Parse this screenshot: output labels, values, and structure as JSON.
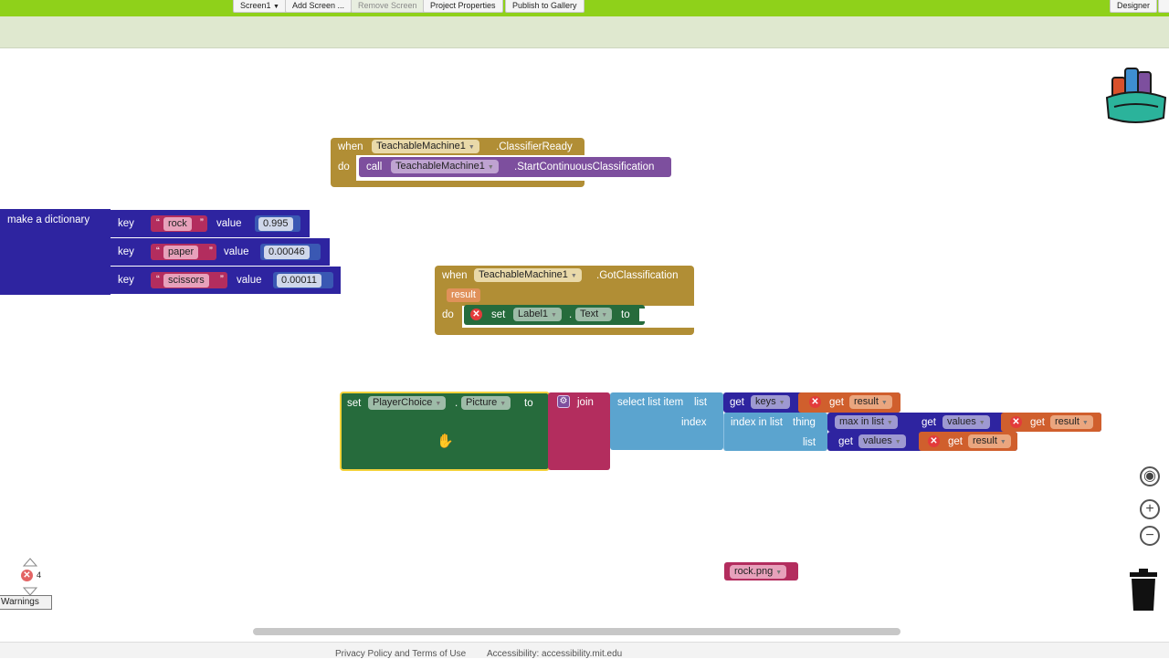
{
  "toolbar": {
    "screen_select": "Screen1",
    "add_screen": "Add Screen ...",
    "remove_screen": "Remove Screen",
    "project_properties": "Project Properties",
    "publish_gallery": "Publish to Gallery",
    "designer": "Designer"
  },
  "blocks": {
    "classifier_ready": {
      "when": "when",
      "component": "TeachableMachine1",
      "event": ".ClassifierReady",
      "do": "do",
      "call": "call",
      "call_component": "TeachableMachine1",
      "method": ".StartContinuousClassification"
    },
    "dictionary": {
      "label": "make a dictionary",
      "entries": [
        {
          "key_label": "key",
          "key": "rock",
          "value_label": "value",
          "value": "0.995"
        },
        {
          "key_label": "key",
          "key": "paper",
          "value_label": "value",
          "value": "0.00046"
        },
        {
          "key_label": "key",
          "key": "scissors",
          "value_label": "value",
          "value": "0.00011"
        }
      ]
    },
    "got_classification": {
      "when": "when",
      "component": "TeachableMachine1",
      "event": ".GotClassification",
      "param": "result",
      "do": "do",
      "set": "set",
      "set_component": "Label1",
      "dot": ".",
      "property": "Text",
      "to": "to"
    },
    "set_picture": {
      "set": "set",
      "component": "PlayerChoice",
      "dot": ".",
      "property": "Picture",
      "to": "to",
      "join": "join",
      "select_list_item": "select list item",
      "list": "list",
      "index": "index",
      "get": "get",
      "keys": "keys",
      "result": "result",
      "index_in_list": "index in list",
      "thing": "thing",
      "max_in_list": "max in list",
      "values": "values"
    },
    "rock_text": "rock.png"
  },
  "warnings": {
    "count": "4",
    "button": "Warnings"
  },
  "footer": {
    "privacy": "Privacy Policy and Terms of Use",
    "accessibility": "Accessibility: accessibility.mit.edu"
  },
  "colors": {
    "topbar": "#8fd11a",
    "event_block": "#b18e35",
    "component_block": "#7d4f9e",
    "dictionary_block": "#2e24a0",
    "text_block": "#b32d5e",
    "setter_block": "#266b3c",
    "list_block": "#5ba4cf",
    "variable_block": "#d05f2d"
  }
}
